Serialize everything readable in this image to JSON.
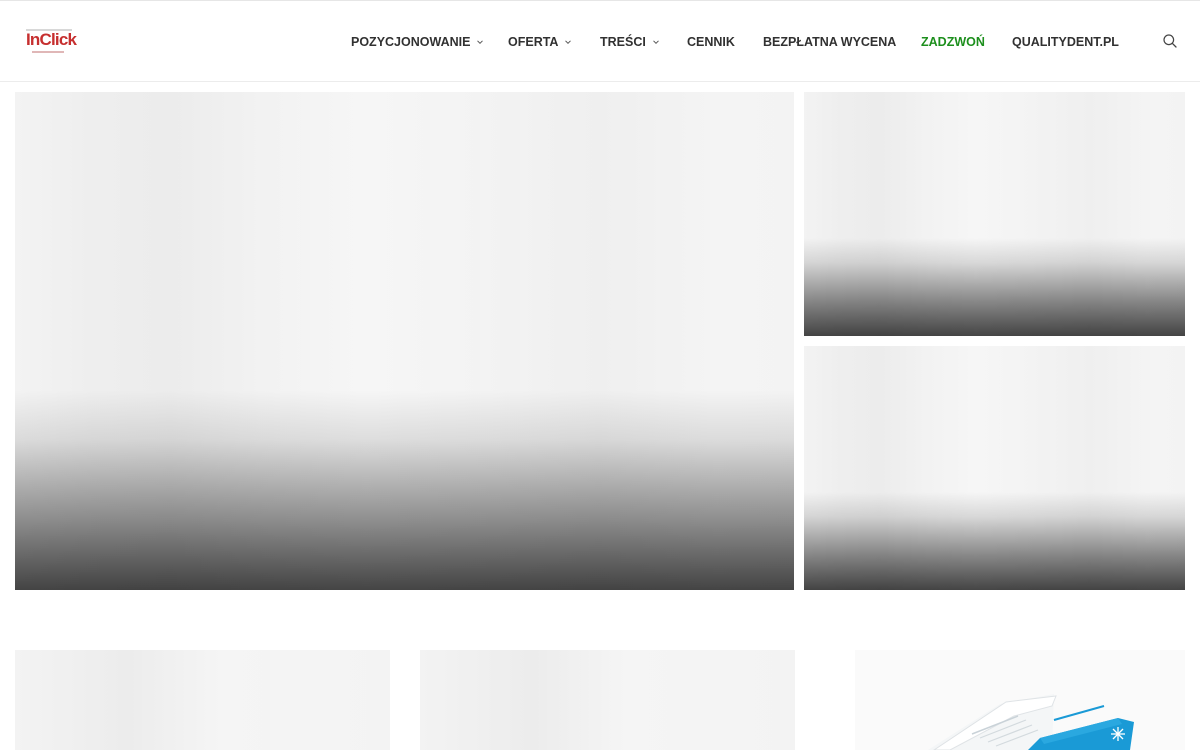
{
  "header": {
    "logo_text": "InClick",
    "nav": [
      {
        "label": "POZYCJONOWANIE",
        "has_dropdown": true
      },
      {
        "label": "OFERTA",
        "has_dropdown": true
      },
      {
        "label": "TREŚCI",
        "has_dropdown": true
      },
      {
        "label": "CENNIK",
        "has_dropdown": false
      },
      {
        "label": "BEZPŁATNA WYCENA",
        "has_dropdown": false
      },
      {
        "label": "ZADZWOŃ",
        "has_dropdown": false,
        "highlight": true
      },
      {
        "label": "QUALITYDENT.PL",
        "has_dropdown": false
      }
    ],
    "search_icon": "search-icon"
  },
  "colors": {
    "text": "#313131",
    "accent_green": "#1d8f1d",
    "logo_red": "#c62f2f",
    "placeholder": "#f3f3f3",
    "doc_blue": "#1a9ad6"
  },
  "featured": [
    {
      "id": "hero-main",
      "state": "loading-placeholder"
    },
    {
      "id": "hero-side-1",
      "state": "loading-placeholder"
    },
    {
      "id": "hero-side-2",
      "state": "loading-placeholder"
    }
  ],
  "posts_grid": [
    {
      "id": "post-1",
      "state": "loading-placeholder"
    },
    {
      "id": "post-2",
      "state": "loading-placeholder"
    },
    {
      "id": "post-3",
      "state": "image",
      "image": "document-illustration"
    }
  ]
}
